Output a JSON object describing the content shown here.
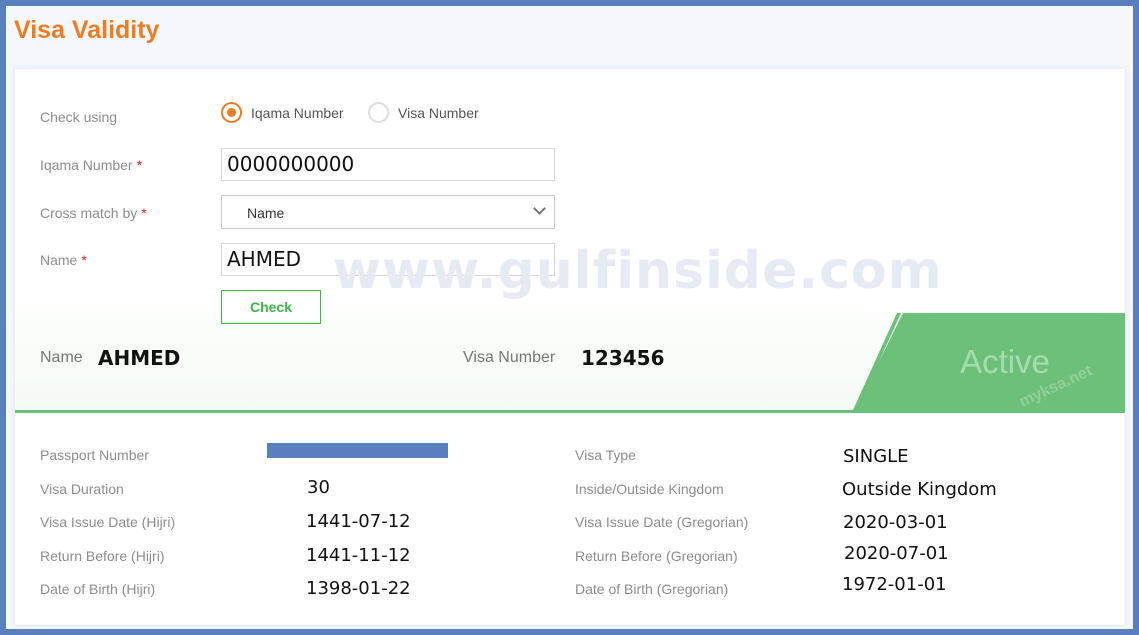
{
  "title": "Visa Validity",
  "form": {
    "check_using_label": "Check using",
    "options": [
      {
        "label": "Iqama Number",
        "selected": true
      },
      {
        "label": "Visa Number",
        "selected": false
      }
    ],
    "iqama_label": "Iqama Number",
    "iqama_value": "0000000000",
    "cross_label": "Cross match by",
    "cross_value": "Name",
    "name_label": "Name",
    "name_value": "AHMED",
    "required": "*",
    "check_button": "Check"
  },
  "result": {
    "name_label": "Name",
    "name_value": "AHMED",
    "visa_label": "Visa Number",
    "visa_value": "123456",
    "status": "Active",
    "status_color": "#6cc07a"
  },
  "details": {
    "left": [
      {
        "label": "Passport Number",
        "value": ""
      },
      {
        "label": "Visa Duration",
        "value": "30"
      },
      {
        "label": "Visa Issue Date (Hijri)",
        "value": "1441-07-12"
      },
      {
        "label": "Return Before (Hijri)",
        "value": "1441-11-12"
      },
      {
        "label": "Date of Birth (Hijri)",
        "value": "1398-01-22"
      }
    ],
    "right": [
      {
        "label": "Visa Type",
        "value": "SINGLE"
      },
      {
        "label": "Inside/Outside Kingdom",
        "value": "Outside Kingdom"
      },
      {
        "label": "Visa Issue Date (Gregorian)",
        "value": "2020-03-01"
      },
      {
        "label": "Return Before (Gregorian)",
        "value": "2020-07-01"
      },
      {
        "label": "Date of Birth (Gregorian)",
        "value": "1972-01-01"
      }
    ]
  },
  "watermarks": [
    "www.gulfinside.com",
    "myksa.net"
  ],
  "colors": {
    "accent": "#f07c22",
    "border": "#5a7fbf",
    "success": "#3cb54a"
  }
}
